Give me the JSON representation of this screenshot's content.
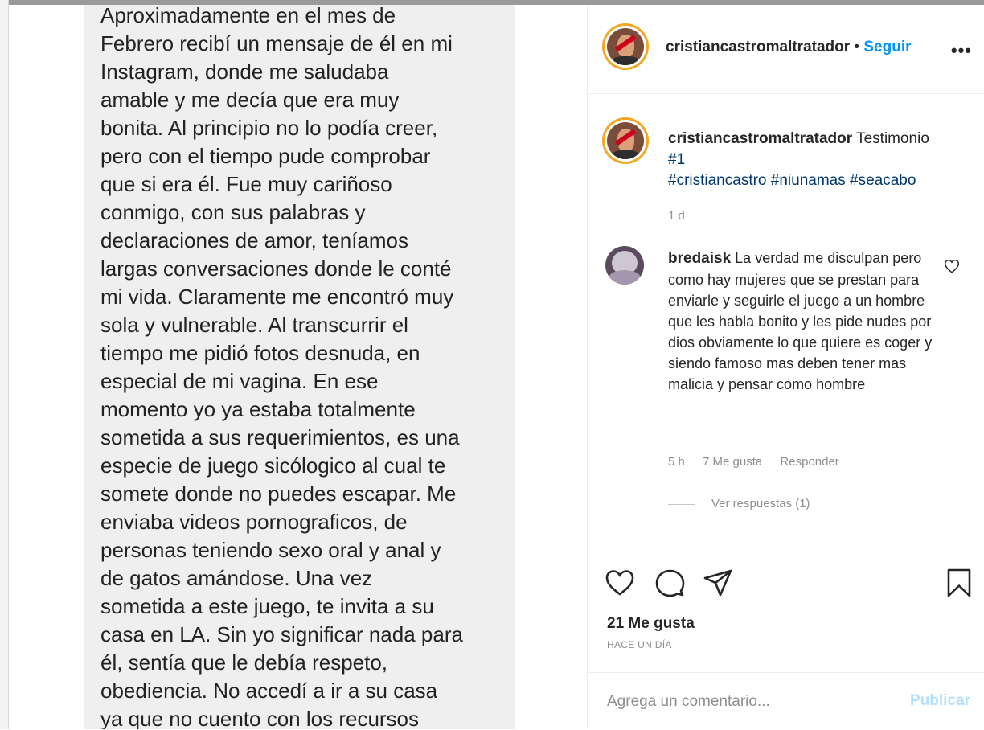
{
  "post": {
    "image_text": "Aproximadamente en el mes de\nFebrero recibí un mensaje de él en mi\nInstagram, donde me saludaba\namable y me decía que era muy\nbonita. Al principio no lo podía creer,\npero con el tiempo pude comprobar\nque si era él. Fue muy cariñoso\nconmigo, con sus palabras y\ndeclaraciones de amor, teníamos\nlargas conversaciones donde le conté\nmi vida. Claramente me encontró muy\nsola y vulnerable. Al transcurrir el\ntiempo me pidió fotos desnuda, en\nespecial de mi vagina. En ese\nmomento yo ya estaba totalmente\nsometida a sus requerimientos, es una\nespecie de juego sicólogico al cual te\nsomete donde no puedes escapar. Me\nenviaba videos pornograficos, de\npersonas teniendo sexo oral y anal y\nde gatos amándose. Una vez\nsometida a este juego, te invita a su\ncasa en LA. Sin yo significar nada para\nél, sentía que le debía respeto,\nobediencia. No accedí a ir a su casa\nya que no cuento con los recursos"
  },
  "header": {
    "username": "cristiancastromaltratador",
    "separator": " • ",
    "follow_label": "Seguir",
    "more_label": "•••"
  },
  "caption": {
    "username": "cristiancastromaltratador",
    "text": "Testimonio",
    "hashtags_line1": "#1",
    "hashtags_line2": "#cristiancastro #niunamas #seacabo",
    "time": "1 d"
  },
  "comment": {
    "username": "bredaisk",
    "text": "La verdad me disculpan pero como hay mujeres que se prestan para enviarle y seguirle el juego a un hombre que les habla bonito y les pide nudes por dios obviamente lo que quiere es coger y siendo famoso mas deben tener mas malicia y pensar como hombre",
    "time": "5 h",
    "likes": "7 Me gusta",
    "reply_label": "Responder",
    "view_replies": "Ver respuestas (1)"
  },
  "actions": {
    "likes_text": "21 Me gusta",
    "time_ago": "HACE UN DÍA"
  },
  "add_comment": {
    "placeholder": "Agrega un comentario...",
    "publish_label": "Publicar"
  },
  "icons": {
    "like": "heart-icon",
    "comment": "comment-bubble-icon",
    "share": "paper-plane-icon",
    "save": "bookmark-icon",
    "comment_like": "small-heart-icon"
  },
  "colors": {
    "link": "#0095f6",
    "hashtag": "#00376b",
    "muted": "#8e8e8e",
    "publish_disabled": "#b2dffc"
  }
}
